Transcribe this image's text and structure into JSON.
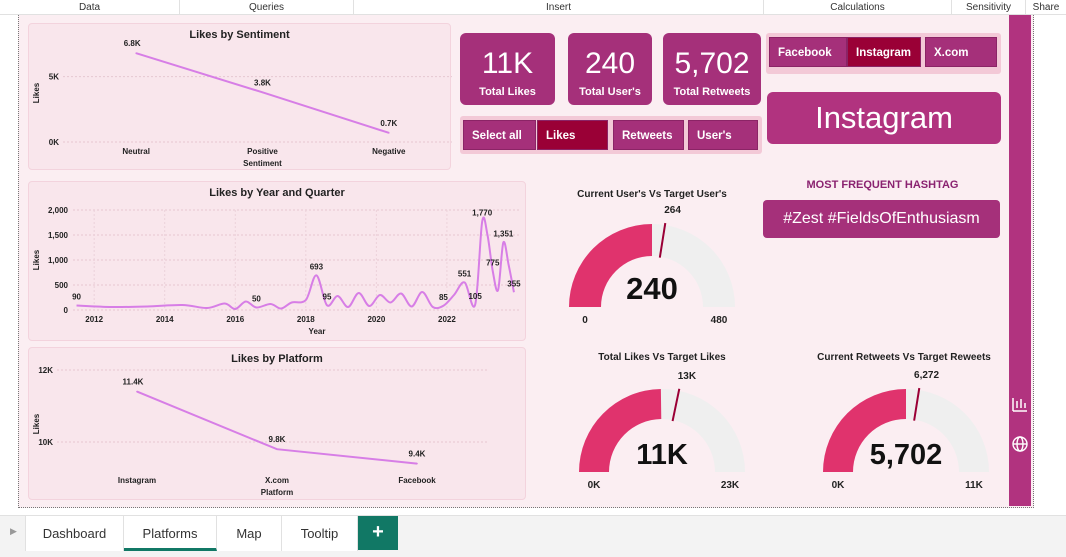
{
  "ribbon": [
    "Data",
    "Queries",
    "Insert",
    "Calculations",
    "Sensitivity",
    "Share"
  ],
  "kpis": [
    {
      "value": "11K",
      "label": "Total Likes"
    },
    {
      "value": "240",
      "label": "Total User's"
    },
    {
      "value": "5,702",
      "label": "Total Retweets"
    }
  ],
  "platform_slicer": {
    "items": [
      "Facebook",
      "Instagram",
      "X.com"
    ],
    "selected": "Instagram"
  },
  "measure_slicer": {
    "items": [
      "Select all",
      "Likes",
      "Retweets",
      "User's"
    ],
    "selected": "Likes"
  },
  "selected_platform_card": "Instagram",
  "hashtag": {
    "label": "MOST FREQUENT HASHTAG",
    "value": "#Zest #FieldsOfEnthusiasm"
  },
  "gauges": [
    {
      "title": "Current User's Vs Target User's",
      "value_label": "240",
      "min_label": "0",
      "max_label": "480",
      "target_label": "264",
      "value": 240,
      "min": 0,
      "max": 480,
      "target": 264
    },
    {
      "title": "Total Likes Vs Target Likes",
      "value_label": "11K",
      "min_label": "0K",
      "max_label": "23K",
      "target_label": "13K",
      "value": 11.4,
      "min": 0,
      "max": 23,
      "target": 13
    },
    {
      "title": "Current Retweets Vs Target Reweets",
      "value_label": "5,702",
      "min_label": "0K",
      "max_label": "11K",
      "target_label": "6,272",
      "value": 5702,
      "min": 0,
      "max": 11404,
      "target": 6272
    }
  ],
  "chart_data": [
    {
      "type": "line",
      "title": "Likes by Sentiment",
      "xlabel": "Sentiment",
      "ylabel": "Likes",
      "categories": [
        "Neutral",
        "Positive",
        "Negative"
      ],
      "values": [
        6800,
        3800,
        700
      ],
      "data_labels": [
        "6.8K",
        "3.8K",
        "0.7K"
      ],
      "yticks": [
        "0K",
        "5K"
      ],
      "ylim": [
        0,
        7500
      ],
      "color": "#d77ee6"
    },
    {
      "type": "line",
      "title": "Likes by Year and Quarter",
      "xlabel": "Year",
      "ylabel": "Likes",
      "x_ticks": [
        "2012",
        "2014",
        "2016",
        "2018",
        "2020",
        "2022"
      ],
      "y_ticks": [
        "0",
        "500",
        "1,000",
        "1,500",
        "2,000"
      ],
      "ylim": [
        0,
        2000
      ],
      "xlim": [
        2011.4,
        2024.1
      ],
      "x": [
        2011.5,
        2012.5,
        2013.5,
        2014.5,
        2015.2,
        2015.7,
        2016.0,
        2016.3,
        2016.6,
        2017.0,
        2017.3,
        2017.6,
        2018.0,
        2018.3,
        2018.6,
        2018.9,
        2019.2,
        2019.5,
        2019.8,
        2020.1,
        2020.4,
        2020.7,
        2021.0,
        2021.3,
        2021.6,
        2021.9,
        2022.2,
        2022.5,
        2022.8,
        2023.0,
        2023.15,
        2023.3,
        2023.45,
        2023.6,
        2023.75,
        2023.9
      ],
      "values": [
        90,
        60,
        70,
        100,
        40,
        130,
        20,
        170,
        50,
        120,
        30,
        150,
        200,
        693,
        95,
        280,
        60,
        340,
        80,
        300,
        150,
        330,
        70,
        360,
        60,
        85,
        300,
        551,
        105,
        1770,
        1500,
        775,
        400,
        1351,
        900,
        355
      ],
      "data_labels": [
        {
          "x": 2011.5,
          "label": "90"
        },
        {
          "x": 2016.6,
          "label": "50"
        },
        {
          "x": 2018.3,
          "label": "693"
        },
        {
          "x": 2018.6,
          "label": "95"
        },
        {
          "x": 2021.9,
          "label": "85"
        },
        {
          "x": 2022.5,
          "label": "551"
        },
        {
          "x": 2022.8,
          "label": "105"
        },
        {
          "x": 2023.0,
          "label": "1,770"
        },
        {
          "x": 2023.3,
          "label": "775"
        },
        {
          "x": 2023.6,
          "label": "1,351"
        },
        {
          "x": 2023.9,
          "label": "355"
        }
      ],
      "color": "#d77ee6"
    },
    {
      "type": "line",
      "title": "Likes by Platform",
      "xlabel": "Platform",
      "ylabel": "Likes",
      "categories": [
        "Instagram",
        "X.com",
        "Facebook"
      ],
      "values": [
        11400,
        9800,
        9400
      ],
      "data_labels": [
        "11.4K",
        "9.8K",
        "9.4K"
      ],
      "yticks": [
        "10K",
        "12K"
      ],
      "ylim": [
        9000,
        12000
      ],
      "color": "#d77ee6"
    }
  ],
  "tabs": [
    {
      "label": "Dashboard",
      "active": false
    },
    {
      "label": "Platforms",
      "active": true
    },
    {
      "label": "Map",
      "active": false
    },
    {
      "label": "Tooltip",
      "active": false
    }
  ],
  "add_tab_label": "+",
  "colors": {
    "accent": "#a5307a",
    "selected": "#9a0036",
    "gauge": "#e0336d",
    "gauge_bg": "#efefef",
    "bg": "#fbeef2"
  }
}
